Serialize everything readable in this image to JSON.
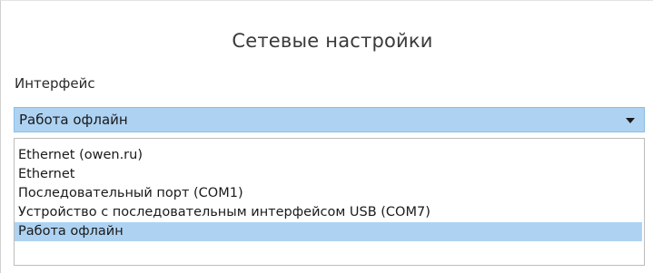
{
  "dialog": {
    "title": "Сетевые настройки",
    "interface_label": "Интерфейс"
  },
  "combo": {
    "selected": "Работа офлайн",
    "arrow_icon": "chevron-down-icon"
  },
  "dropdown": {
    "options": [
      {
        "label": "Ethernet (owen.ru)",
        "selected": false
      },
      {
        "label": "Ethernet",
        "selected": false
      },
      {
        "label": "Последовательный порт (COM1)",
        "selected": false
      },
      {
        "label": "Устройство с последовательным интерфейсом USB (COM7)",
        "selected": false
      },
      {
        "label": "Работа офлайн",
        "selected": true
      }
    ]
  },
  "colors": {
    "selection": "#aed3f2",
    "border": "#bdbdbd"
  }
}
